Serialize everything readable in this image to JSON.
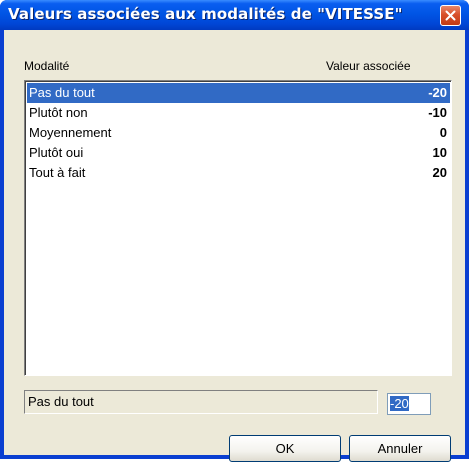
{
  "window": {
    "title": "Valeurs associées aux modalités de \"VITESSE\""
  },
  "list": {
    "header_left": "Modalité",
    "header_right": "Valeur associée",
    "rows": [
      {
        "label": "Pas du tout",
        "value": "-20",
        "selected": true
      },
      {
        "label": "Plutôt non",
        "value": "-10",
        "selected": false
      },
      {
        "label": "Moyennement",
        "value": "0",
        "selected": false
      },
      {
        "label": "Plutôt oui",
        "value": "10",
        "selected": false
      },
      {
        "label": "Tout à fait",
        "value": "20",
        "selected": false
      }
    ]
  },
  "edit": {
    "selected_label": "Pas du tout",
    "value": "-20"
  },
  "buttons": {
    "ok_label": "OK",
    "cancel_label": "Annuler"
  },
  "colors": {
    "selection": "#316ac5",
    "titlebar": "#0055e5",
    "dialog_bg": "#ece9d8"
  },
  "icons": {
    "close": "close-icon"
  }
}
